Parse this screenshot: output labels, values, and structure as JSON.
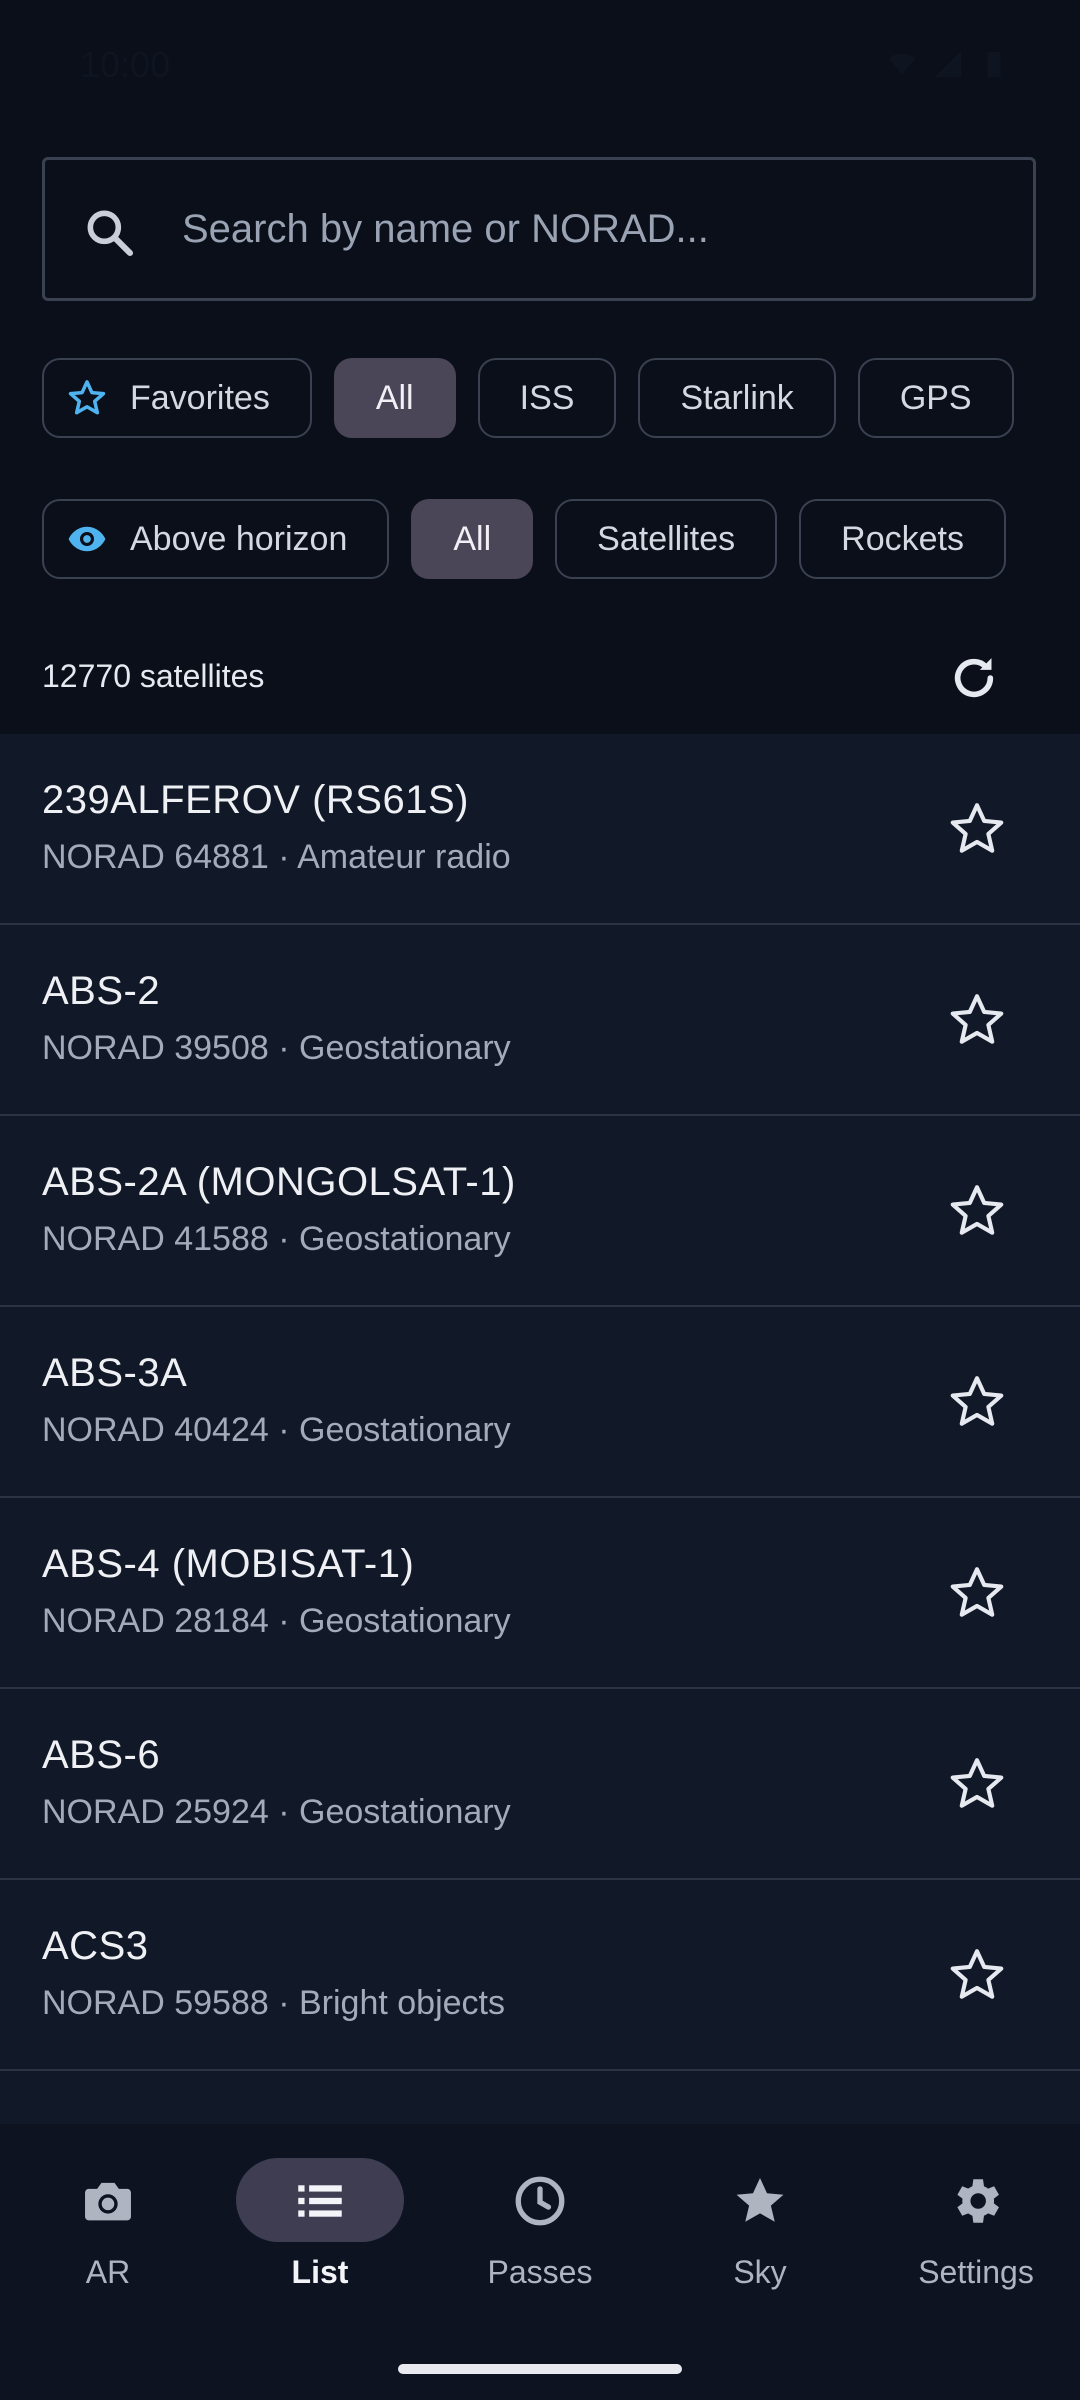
{
  "status": {
    "time": "10:00"
  },
  "search": {
    "placeholder": "Search by name or NORAD..."
  },
  "filters_row1": [
    {
      "label": "Favorites",
      "icon": "star-outline-icon",
      "selected": false
    },
    {
      "label": "All",
      "selected": true
    },
    {
      "label": "ISS",
      "selected": false
    },
    {
      "label": "Starlink",
      "selected": false
    },
    {
      "label": "GPS",
      "selected": false
    }
  ],
  "filters_row2": [
    {
      "label": "Above horizon",
      "icon": "eye-icon",
      "selected": false
    },
    {
      "label": "All",
      "selected": true
    },
    {
      "label": "Satellites",
      "selected": false
    },
    {
      "label": "Rockets",
      "selected": false
    }
  ],
  "count_label": "12770 satellites",
  "satellites": [
    {
      "name": "239ALFEROV (RS61S)",
      "detail": "NORAD 64881 · Amateur radio"
    },
    {
      "name": "ABS-2",
      "detail": "NORAD 39508 · Geostationary"
    },
    {
      "name": "ABS-2A (MONGOLSAT-1)",
      "detail": "NORAD 41588 · Geostationary"
    },
    {
      "name": "ABS-3A",
      "detail": "NORAD 40424 · Geostationary"
    },
    {
      "name": "ABS-4 (MOBISAT-1)",
      "detail": "NORAD 28184 · Geostationary"
    },
    {
      "name": "ABS-6",
      "detail": "NORAD 25924 · Geostationary"
    },
    {
      "name": "ACS3",
      "detail": "NORAD 59588 · Bright objects"
    }
  ],
  "nav": [
    {
      "label": "AR",
      "icon": "camera-icon",
      "active": false
    },
    {
      "label": "List",
      "icon": "list-icon",
      "active": true
    },
    {
      "label": "Passes",
      "icon": "clock-icon",
      "active": false
    },
    {
      "label": "Sky",
      "icon": "star-filled-icon",
      "active": false
    },
    {
      "label": "Settings",
      "icon": "gear-icon",
      "active": false
    }
  ],
  "colors": {
    "accent": "#4fb3f0",
    "selected_chip": "#4a4658",
    "background": "#0a0f1a",
    "list_bg": "#111827"
  }
}
